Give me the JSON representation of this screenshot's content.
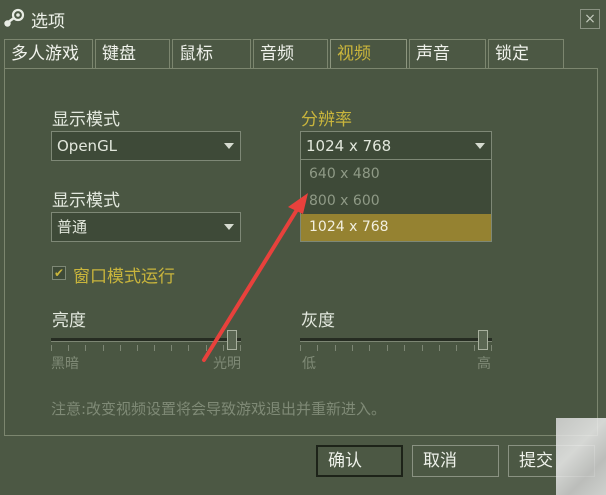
{
  "window": {
    "title": "选项",
    "close_glyph": "×"
  },
  "tabs": [
    {
      "label": "多人游戏",
      "active": false
    },
    {
      "label": "键盘",
      "active": false
    },
    {
      "label": "鼠标",
      "active": false
    },
    {
      "label": "音频",
      "active": false
    },
    {
      "label": "视频",
      "active": true
    },
    {
      "label": "声音",
      "active": false
    },
    {
      "label": "锁定",
      "active": false
    }
  ],
  "video": {
    "display_mode_label": "显示模式",
    "display_mode_value": "OpenGL",
    "display_quality_label": "显示模式",
    "display_quality_value": "普通",
    "resolution_label": "分辨率",
    "resolution_value": "1024 x 768",
    "resolution_options": [
      "640 x 480",
      "800 x 600",
      "1024 x 768"
    ],
    "resolution_selected_index": 2,
    "windowed_label": "窗口模式运行",
    "windowed_checked": true,
    "brightness_label": "亮度",
    "brightness_min_label": "黑暗",
    "brightness_max_label": "光明",
    "brightness_value": 0.98,
    "gamma_label": "灰度",
    "gamma_min_label": "低",
    "gamma_max_label": "高",
    "gamma_value": 0.98,
    "note": "注意:改变视频设置将会导致游戏退出并重新进入。"
  },
  "buttons": {
    "ok": "确认",
    "cancel": "取消",
    "apply": "提交"
  },
  "icons": {
    "logo": "steam-logo",
    "close": "close-icon",
    "dropdown": "chevron-down-icon",
    "check": "checkmark-icon"
  },
  "colors": {
    "panel": "#4a5642",
    "accent": "#c9b53c",
    "selection": "#958231",
    "annotation_arrow": "#e8413c"
  }
}
